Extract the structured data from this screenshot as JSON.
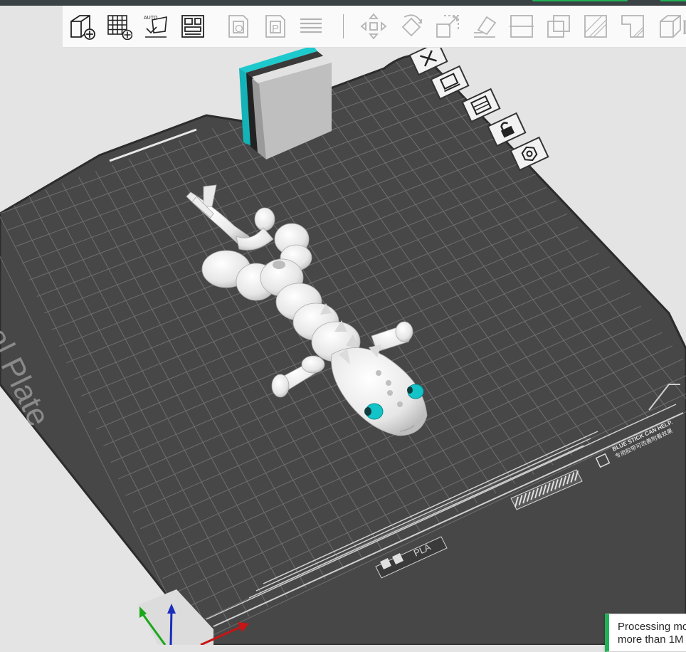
{
  "toolbar": {
    "tools": [
      {
        "name": "add-object",
        "enabled": true
      },
      {
        "name": "add-plate",
        "enabled": true
      },
      {
        "name": "auto-orient",
        "enabled": true,
        "badge": "AUTO"
      },
      {
        "name": "arrange",
        "enabled": true
      },
      {
        "name": "split-to-objects",
        "enabled": false,
        "glyph": "O"
      },
      {
        "name": "split-to-parts",
        "enabled": false,
        "glyph": "P"
      },
      {
        "name": "layers",
        "enabled": false
      },
      {
        "name": "move",
        "enabled": false
      },
      {
        "name": "rotate",
        "enabled": false
      },
      {
        "name": "scale",
        "enabled": false
      },
      {
        "name": "lay-on-face",
        "enabled": false
      },
      {
        "name": "cut",
        "enabled": false
      },
      {
        "name": "boolean",
        "enabled": false
      },
      {
        "name": "support-paint",
        "enabled": false
      },
      {
        "name": "seam-paint",
        "enabled": false
      },
      {
        "name": "measure",
        "enabled": false
      },
      {
        "name": "text",
        "enabled": false,
        "glyph": "Ta"
      }
    ]
  },
  "plate": {
    "name_text": "al Plate",
    "notice_line1": "BLUE STICK CAN HELP.",
    "notice_line2": "专用胶带可改善附着效果",
    "material": "PLA",
    "colors": {
      "plate": "#474747",
      "grid": "#6e6e6e",
      "border": "#2c2c2c",
      "wipe_tower_accent": "#12c3c8"
    }
  },
  "plate_tools": [
    "close-icon",
    "screen-icon",
    "layout-icon",
    "lock-icon",
    "settings-icon"
  ],
  "toast": {
    "line1": "Processing mo",
    "line2": "more than 1M",
    "accent": "#1fb355"
  }
}
